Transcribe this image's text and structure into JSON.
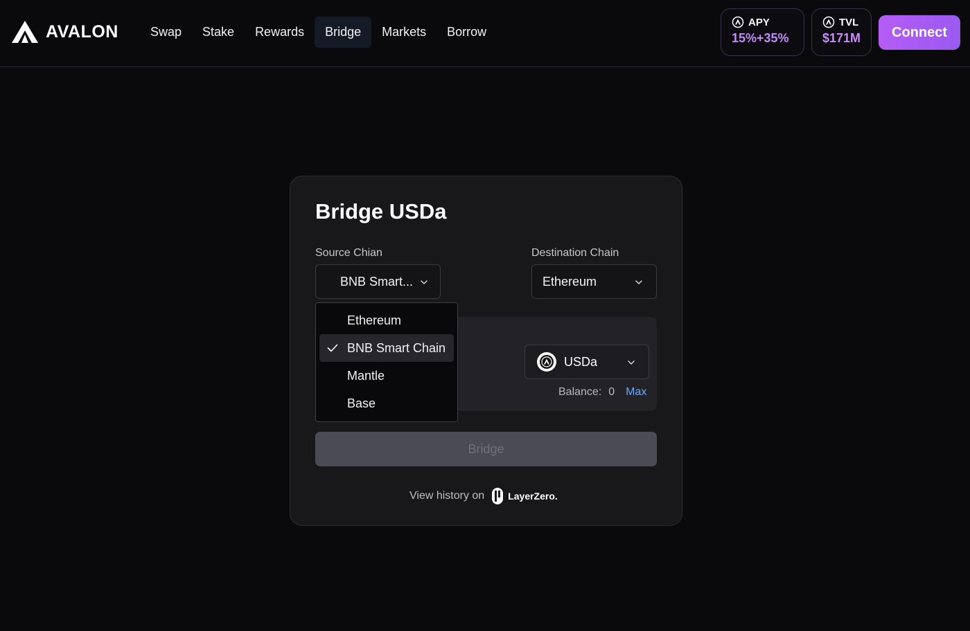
{
  "header": {
    "logo_text": "AVALON",
    "nav": [
      "Swap",
      "Stake",
      "Rewards",
      "Bridge",
      "Markets",
      "Borrow"
    ],
    "active_nav": "Bridge",
    "apy": {
      "label": "APY",
      "value": "15%+35%"
    },
    "tvl": {
      "label": "TVL",
      "value": "$171M"
    },
    "connect_label": "Connect"
  },
  "card": {
    "title": "Bridge USDa",
    "source_label": "Source Chian",
    "source_value": "BNB Smart...",
    "destination_label": "Destination Chain",
    "destination_value": "Ethereum",
    "token": "USDa",
    "balance_label": "Balance:",
    "balance_value": "0",
    "max_label": "Max",
    "bridge_label": "Bridge",
    "history_text": "View history on",
    "layerzero_text": "LayerZero."
  },
  "dropdown": {
    "options": [
      "Ethereum",
      "BNB Smart Chain",
      "Mantle",
      "Base"
    ],
    "selected": "BNB Smart Chain"
  },
  "colors": {
    "accent": "#b55cf6",
    "stat_value": "#c58cf7",
    "link": "#6aaaf7",
    "disabled_button": "#4a4b55"
  },
  "icons": {
    "logo": "avalon-logo-icon",
    "stat": "avalon-circle-icon",
    "chevron": "chevron-down-icon",
    "check": "check-icon",
    "layerzero": "layerzero-logo-icon"
  }
}
